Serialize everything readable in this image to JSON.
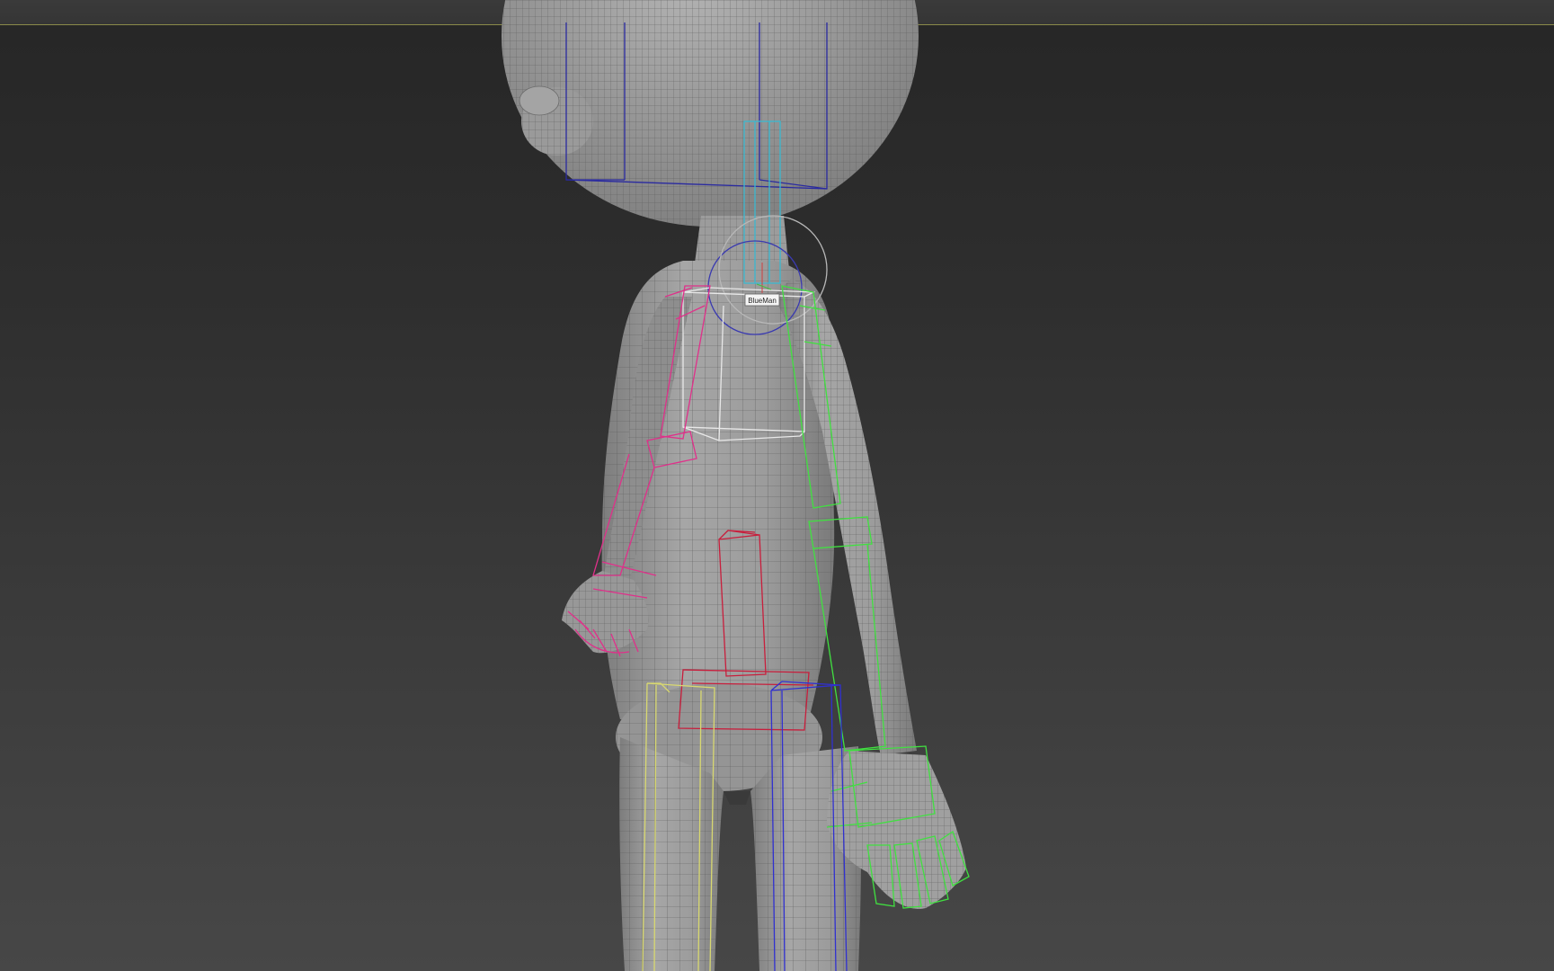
{
  "viewport": {
    "object_label": "BlueMan"
  },
  "colors": {
    "mesh_fill": "#9a9a9a",
    "wire": "#5c5c5c",
    "left_arm_bone": "#e0308a",
    "right_arm_bone": "#40e040",
    "spine_bone": "#c81e3c",
    "left_leg_bone": "#d8d870",
    "right_leg_bone": "#3030d0",
    "head_bone": "#2a2aa0",
    "neck_bone": "#3ab8d0",
    "pelvis_box": "#e8e8e8"
  }
}
